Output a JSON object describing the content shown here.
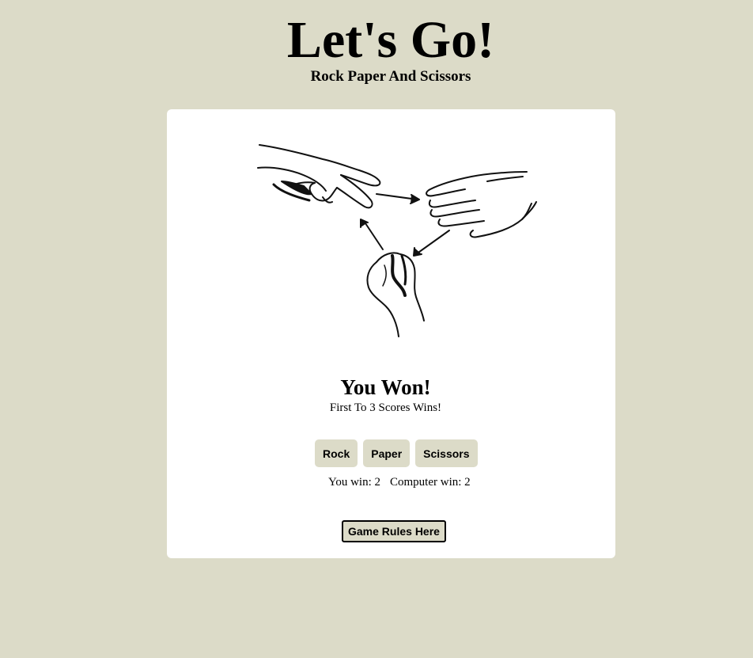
{
  "header": {
    "title": "Let's Go!",
    "subtitle": "Rock Paper And Scissors"
  },
  "game": {
    "result": "You Won!",
    "rule_text": "First To 3 Scores Wins!",
    "choices": [
      "Rock",
      "Paper",
      "Scissors"
    ],
    "score": {
      "you_label": "You win: 2",
      "computer_label": "Computer win: 2",
      "you": 2,
      "computer": 2
    },
    "rules_button": "Game Rules Here"
  },
  "illustration": {
    "icon": "rock-paper-scissors-hands-cycle"
  },
  "colors": {
    "background": "#dcdbc8",
    "card": "#ffffff",
    "button": "#dcdbc8"
  }
}
